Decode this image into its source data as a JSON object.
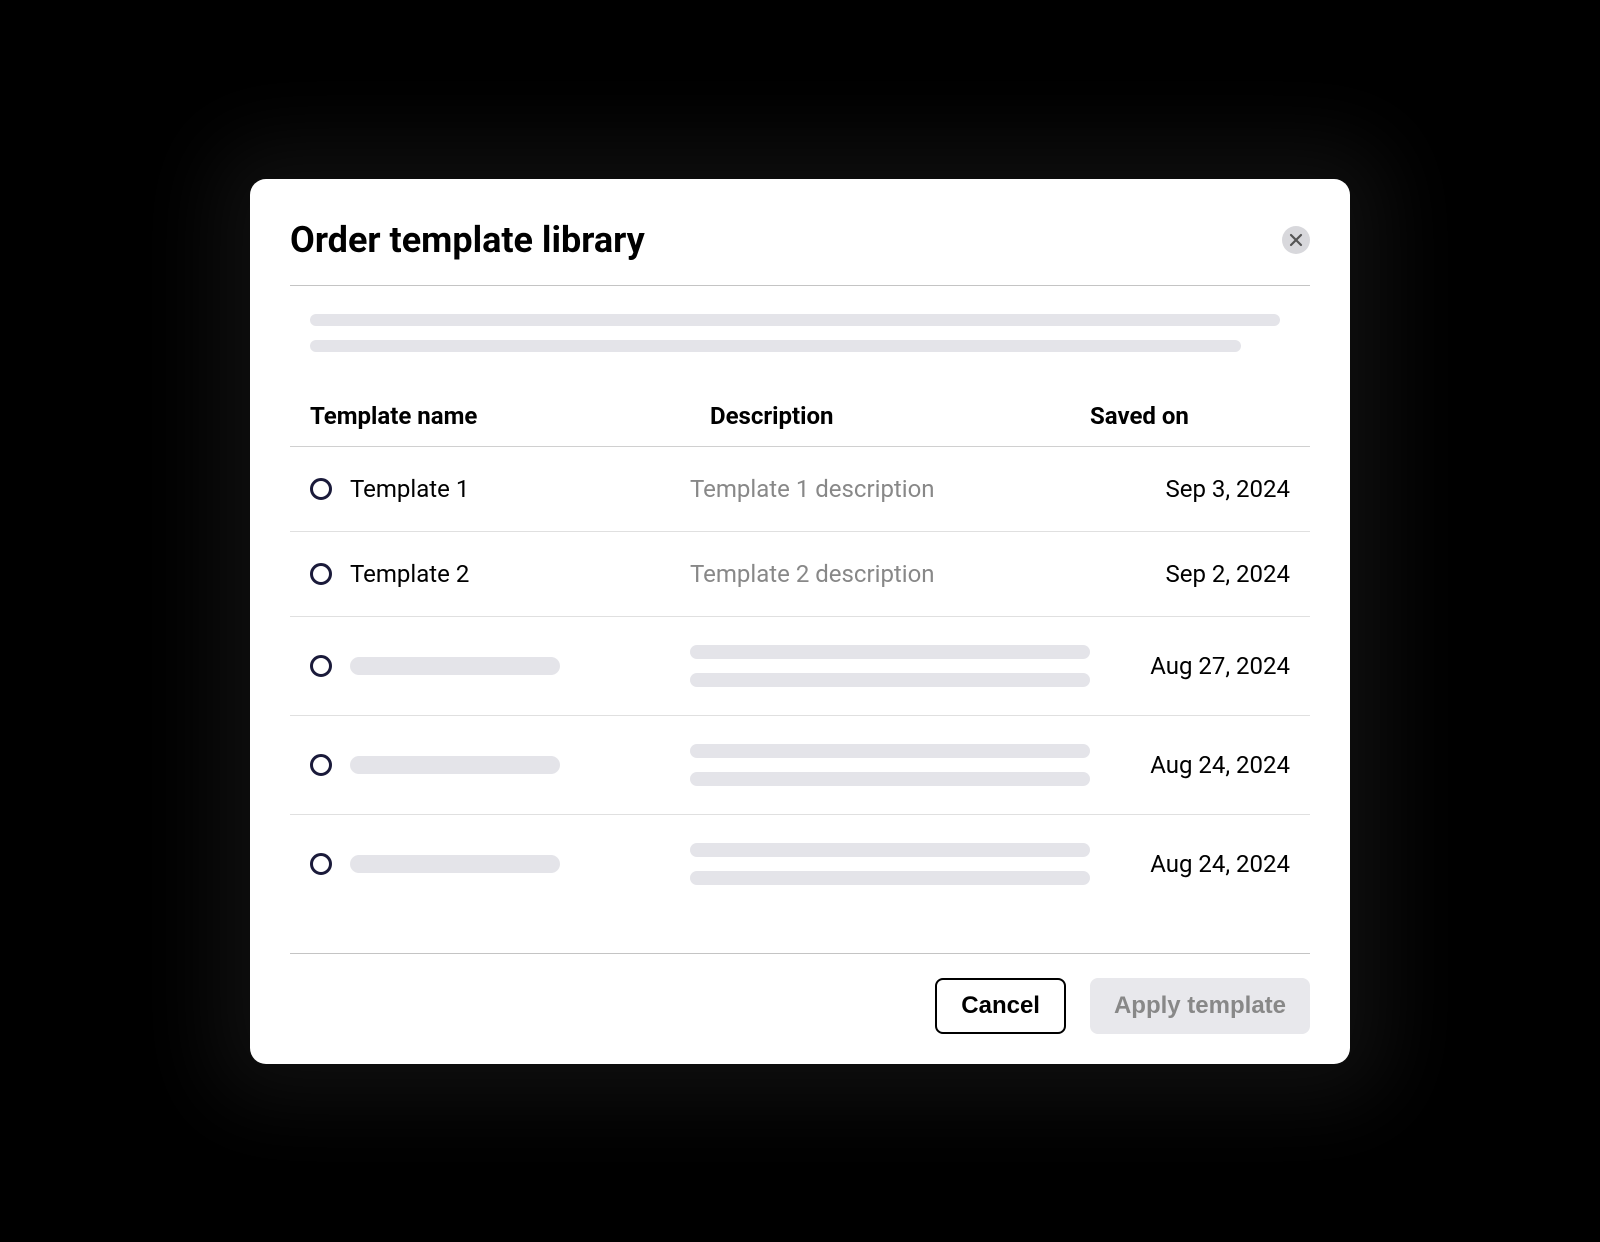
{
  "modal": {
    "title": "Order template library",
    "close_label": "Close"
  },
  "table": {
    "headers": {
      "name": "Template name",
      "description": "Description",
      "saved_on": "Saved on"
    },
    "rows": [
      {
        "name": "Template 1",
        "description": "Template 1 description",
        "saved_on": "Sep 3, 2024",
        "placeholder": false
      },
      {
        "name": "Template 2",
        "description": "Template 2 description",
        "saved_on": "Sep 2, 2024",
        "placeholder": false
      },
      {
        "name": "",
        "description": "",
        "saved_on": "Aug 27, 2024",
        "placeholder": true
      },
      {
        "name": "",
        "description": "",
        "saved_on": "Aug 24, 2024",
        "placeholder": true
      },
      {
        "name": "",
        "description": "",
        "saved_on": "Aug 24, 2024",
        "placeholder": true
      }
    ]
  },
  "footer": {
    "cancel_label": "Cancel",
    "apply_label": "Apply template"
  }
}
